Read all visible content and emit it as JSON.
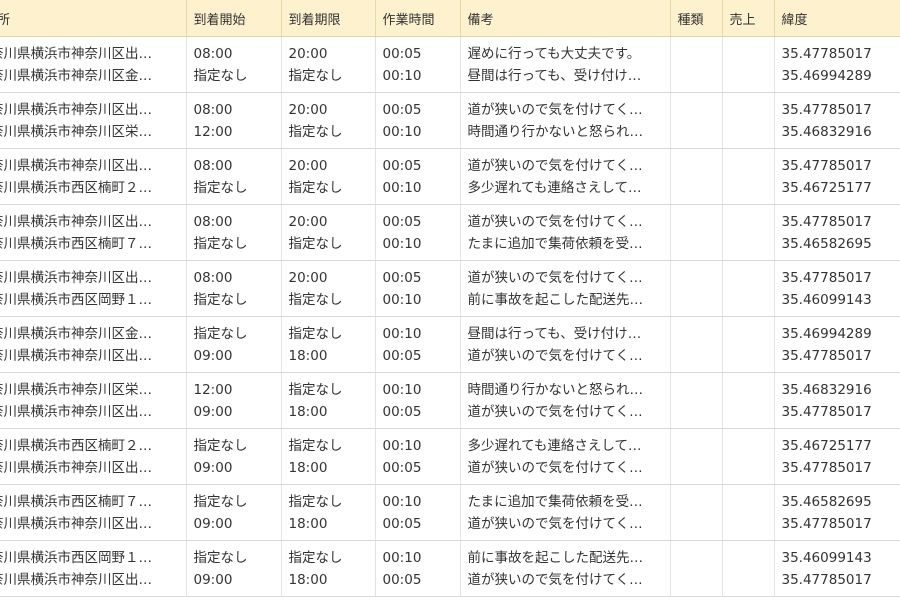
{
  "columns": {
    "address": "所",
    "arrival_start": "到着開始",
    "arrival_deadline": "到着期限",
    "work_time": "作業時間",
    "note": "備考",
    "kind": "種類",
    "sales": "売上",
    "latitude": "緯度"
  },
  "rows": [
    {
      "address": [
        "奈川県横浜市神奈川区出…",
        "奈川県横浜市神奈川区金…"
      ],
      "start": [
        "08:00",
        "指定なし"
      ],
      "deadline": [
        "20:00",
        "指定なし"
      ],
      "work": [
        "00:05",
        "00:10"
      ],
      "note": [
        "遅めに行っても大丈夫です。",
        "昼間は行っても、受け付け…"
      ],
      "lat": [
        "35.47785017",
        "35.46994289"
      ]
    },
    {
      "address": [
        "奈川県横浜市神奈川区出…",
        "奈川県横浜市神奈川区栄…"
      ],
      "start": [
        "08:00",
        "12:00"
      ],
      "deadline": [
        "20:00",
        "指定なし"
      ],
      "work": [
        "00:05",
        "00:10"
      ],
      "note": [
        "道が狭いので気を付けてく…",
        "時間通り行かないと怒られ…"
      ],
      "lat": [
        "35.47785017",
        "35.46832916"
      ]
    },
    {
      "address": [
        "奈川県横浜市神奈川区出…",
        "奈川県横浜市西区楠町２…"
      ],
      "start": [
        "08:00",
        "指定なし"
      ],
      "deadline": [
        "20:00",
        "指定なし"
      ],
      "work": [
        "00:05",
        "00:10"
      ],
      "note": [
        "道が狭いので気を付けてく…",
        "多少遅れても連絡さえして…"
      ],
      "lat": [
        "35.47785017",
        "35.46725177"
      ]
    },
    {
      "address": [
        "奈川県横浜市神奈川区出…",
        "奈川県横浜市西区楠町７…"
      ],
      "start": [
        "08:00",
        "指定なし"
      ],
      "deadline": [
        "20:00",
        "指定なし"
      ],
      "work": [
        "00:05",
        "00:10"
      ],
      "note": [
        "道が狭いので気を付けてく…",
        "たまに追加で集荷依頼を受…"
      ],
      "lat": [
        "35.47785017",
        "35.46582695"
      ]
    },
    {
      "address": [
        "奈川県横浜市神奈川区出…",
        "奈川県横浜市西区岡野１…"
      ],
      "start": [
        "08:00",
        "指定なし"
      ],
      "deadline": [
        "20:00",
        "指定なし"
      ],
      "work": [
        "00:05",
        "00:10"
      ],
      "note": [
        "道が狭いので気を付けてく…",
        "前に事故を起こした配送先…"
      ],
      "lat": [
        "35.47785017",
        "35.46099143"
      ]
    },
    {
      "address": [
        "奈川県横浜市神奈川区金…",
        "奈川県横浜市神奈川区出…"
      ],
      "start": [
        "指定なし",
        "09:00"
      ],
      "deadline": [
        "指定なし",
        "18:00"
      ],
      "work": [
        "00:10",
        "00:05"
      ],
      "note": [
        "昼間は行っても、受け付け…",
        "道が狭いので気を付けてく…"
      ],
      "lat": [
        "35.46994289",
        "35.47785017"
      ]
    },
    {
      "address": [
        "奈川県横浜市神奈川区栄…",
        "奈川県横浜市神奈川区出…"
      ],
      "start": [
        "12:00",
        "09:00"
      ],
      "deadline": [
        "指定なし",
        "18:00"
      ],
      "work": [
        "00:10",
        "00:05"
      ],
      "note": [
        "時間通り行かないと怒られ…",
        "道が狭いので気を付けてく…"
      ],
      "lat": [
        "35.46832916",
        "35.47785017"
      ]
    },
    {
      "address": [
        "奈川県横浜市西区楠町２…",
        "奈川県横浜市神奈川区出…"
      ],
      "start": [
        "指定なし",
        "09:00"
      ],
      "deadline": [
        "指定なし",
        "18:00"
      ],
      "work": [
        "00:10",
        "00:05"
      ],
      "note": [
        "多少遅れても連絡さえして…",
        "道が狭いので気を付けてく…"
      ],
      "lat": [
        "35.46725177",
        "35.47785017"
      ]
    },
    {
      "address": [
        "奈川県横浜市西区楠町７…",
        "奈川県横浜市神奈川区出…"
      ],
      "start": [
        "指定なし",
        "09:00"
      ],
      "deadline": [
        "指定なし",
        "18:00"
      ],
      "work": [
        "00:10",
        "00:05"
      ],
      "note": [
        "たまに追加で集荷依頼を受…",
        "道が狭いので気を付けてく…"
      ],
      "lat": [
        "35.46582695",
        "35.47785017"
      ]
    },
    {
      "address": [
        "奈川県横浜市西区岡野１…",
        "奈川県横浜市神奈川区出…"
      ],
      "start": [
        "指定なし",
        "09:00"
      ],
      "deadline": [
        "指定なし",
        "18:00"
      ],
      "work": [
        "00:10",
        "00:05"
      ],
      "note": [
        "前に事故を起こした配送先…",
        "道が狭いので気を付けてく…"
      ],
      "lat": [
        "35.46099143",
        "35.47785017"
      ]
    }
  ],
  "colors": {
    "header_bg": "#fdf1ce",
    "row_border": "#d9d9d9",
    "text": "#333333"
  }
}
